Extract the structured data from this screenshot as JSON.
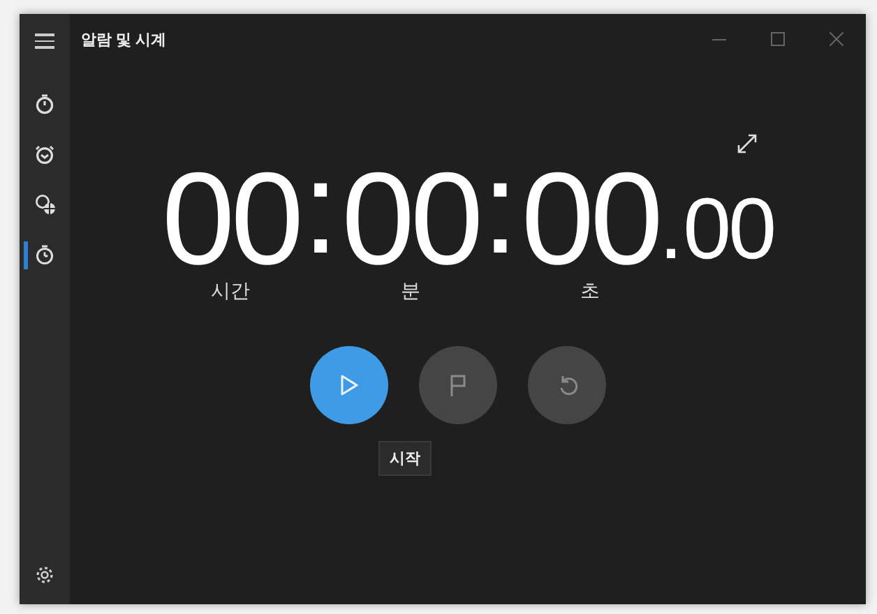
{
  "window": {
    "title": "알람 및 시계"
  },
  "nav": [
    {
      "kind": "timer",
      "selected": false
    },
    {
      "kind": "alarm",
      "selected": false
    },
    {
      "kind": "world",
      "selected": false
    },
    {
      "kind": "stopwatch",
      "selected": true
    }
  ],
  "display": [
    {
      "kind": "unit",
      "value": "00",
      "label": "시간"
    },
    {
      "kind": "sep",
      "value": ":"
    },
    {
      "kind": "unit",
      "value": "00",
      "label": "분"
    },
    {
      "kind": "sep",
      "value": ":"
    },
    {
      "kind": "unit",
      "value": "00",
      "label": "초"
    },
    {
      "kind": "dot",
      "value": "."
    },
    {
      "kind": "fraction",
      "value": "00"
    }
  ],
  "controls": [
    {
      "kind": "play",
      "disabled": false
    },
    {
      "kind": "lap",
      "disabled": true
    },
    {
      "kind": "reset",
      "disabled": true
    }
  ],
  "tooltip": "시작"
}
